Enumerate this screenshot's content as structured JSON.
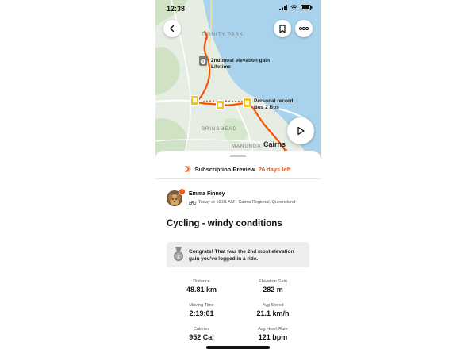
{
  "status_bar": {
    "time": "12:38"
  },
  "map": {
    "labels": {
      "trinity_park": "TRINITY PARK",
      "brinsmead": "BRINSMEAD",
      "manunda": "MANUNDA",
      "cairns": "Cairns"
    },
    "annotations": {
      "elevation_line1": "2nd most elevation gain",
      "elevation_line2": "Lifetime",
      "pr_line1": "Personal record",
      "pr_line2": "Bus 2 Bus"
    },
    "colors": {
      "water": "#a9d3ec",
      "land": "#e6ede2",
      "route": "#fc5200",
      "park": "#cfe3c4"
    }
  },
  "subscription": {
    "label": "Subscription Preview",
    "days_left": "26 days left"
  },
  "activity": {
    "athlete_name": "Emma Finney",
    "meta": "Today at 10:01 AM · Cairns Regional, Queensland",
    "title": "Cycling - windy conditions",
    "congrats": "Congrats! That was the 2nd most elevation gain you've logged in a ride.",
    "medal_number": "2"
  },
  "stats": {
    "distance": {
      "label": "Distance",
      "value": "48.81 km"
    },
    "elevation": {
      "label": "Elevation Gain",
      "value": "282 m"
    },
    "moving_time": {
      "label": "Moving Time",
      "value": "2:19:01"
    },
    "avg_speed": {
      "label": "Avg Speed",
      "value": "21.1 km/h"
    },
    "calories": {
      "label": "Calories",
      "value": "952 Cal"
    },
    "avg_hr": {
      "label": "Avg Heart Rate",
      "value": "121 bpm"
    }
  }
}
